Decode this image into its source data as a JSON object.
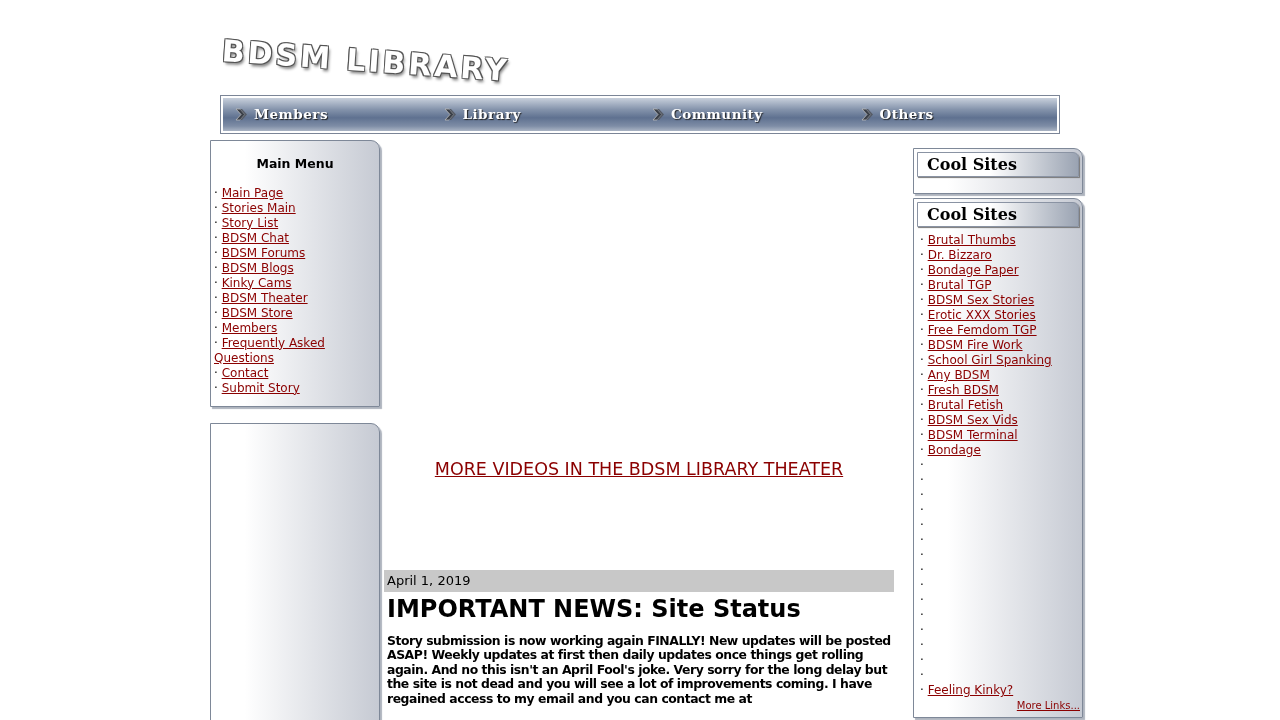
{
  "logo": "BDSM LIBRARY",
  "nav": [
    {
      "label": "Members"
    },
    {
      "label": "Library"
    },
    {
      "label": "Community"
    },
    {
      "label": "Others"
    }
  ],
  "main_menu": {
    "title": "Main Menu",
    "items": [
      {
        "bullet": "·",
        "label": "Main Page"
      },
      {
        "bullet": "·",
        "label": "Stories Main"
      },
      {
        "bullet": "·",
        "label": "Story List"
      },
      {
        "bullet": "·",
        "label": "BDSM Chat"
      },
      {
        "bullet": "·",
        "label": "BDSM Forums"
      },
      {
        "bullet": "·",
        "label": "BDSM Blogs"
      },
      {
        "bullet": "·",
        "label": "Kinky Cams"
      },
      {
        "bullet": "·",
        "label": "BDSM Theater"
      },
      {
        "bullet": "·",
        "label": "BDSM Store"
      },
      {
        "bullet": "·",
        "label": "Members"
      },
      {
        "bullet": "·",
        "label": "Frequently Asked Questions"
      },
      {
        "bullet": "·",
        "label": "Contact"
      },
      {
        "bullet": "·",
        "label": "Submit Story"
      }
    ]
  },
  "theater_link": "MORE VIDEOS IN THE BDSM LIBRARY THEATER",
  "news": {
    "date": "April 1, 2019",
    "title": "IMPORTANT NEWS: Site Status",
    "body": "Story submission is now working again FINALLY! New updates will be posted ASAP! Weekly updates at first then daily updates once things get rolling again. And no this isn't an April Fool's joke. Very sorry for the long delay but the site is not dead and you will see a lot of improvements coming. I have regained access to my email and you can contact me at"
  },
  "cool_sites_top": {
    "title": "Cool Sites"
  },
  "cool_sites": {
    "title": "Cool Sites",
    "items": [
      {
        "bullet": "·",
        "label": "Brutal Thumbs"
      },
      {
        "bullet": "·",
        "label": "Dr. Bizzaro"
      },
      {
        "bullet": "·",
        "label": "Bondage Paper"
      },
      {
        "bullet": "·",
        "label": "Brutal TGP"
      },
      {
        "bullet": "·",
        "label": "BDSM Sex Stories"
      },
      {
        "bullet": "·",
        "label": "Erotic XXX Stories"
      },
      {
        "bullet": "·",
        "label": "Free Femdom TGP"
      },
      {
        "bullet": "·",
        "label": "BDSM Fire Work"
      },
      {
        "bullet": "·",
        "label": "School Girl Spanking"
      },
      {
        "bullet": "·",
        "label": "Any BDSM"
      },
      {
        "bullet": "·",
        "label": "Fresh BDSM"
      },
      {
        "bullet": "·",
        "label": "Brutal Fetish"
      },
      {
        "bullet": "·",
        "label": "BDSM Sex Vids"
      },
      {
        "bullet": "·",
        "label": "BDSM Terminal"
      },
      {
        "bullet": "·",
        "label": "Bondage"
      },
      {
        "bullet": "·"
      },
      {
        "bullet": "·"
      },
      {
        "bullet": "·"
      },
      {
        "bullet": "·"
      },
      {
        "bullet": "·"
      },
      {
        "bullet": "·"
      },
      {
        "bullet": "·"
      },
      {
        "bullet": "·"
      },
      {
        "bullet": "·"
      },
      {
        "bullet": "·"
      },
      {
        "bullet": "·"
      },
      {
        "bullet": "·"
      },
      {
        "bullet": "·"
      },
      {
        "bullet": "·"
      },
      {
        "bullet": "·"
      },
      {
        "bullet": "·",
        "label": "Feeling Kinky?"
      }
    ],
    "more_link": "More Links..."
  }
}
